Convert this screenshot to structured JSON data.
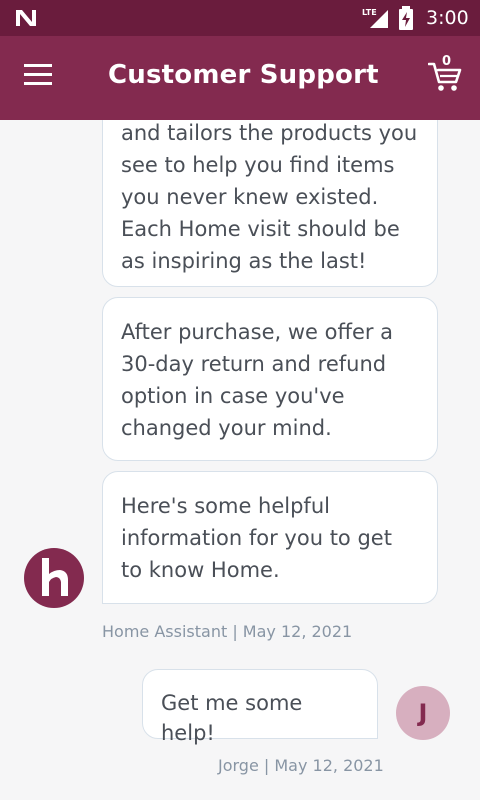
{
  "status_bar": {
    "network": "LTE",
    "time": "3:00"
  },
  "app_bar": {
    "title": "Customer Support",
    "cart_count": "0",
    "icons": [
      "menu-icon",
      "cart-icon"
    ]
  },
  "messages": [
    {
      "sender": "bot",
      "text": "and tailors the products you see to help you find items you never knew existed. Each Home visit should be as inspiring as the last!"
    },
    {
      "sender": "bot",
      "text": "After purchase, we offer a 30-day return and refund option in case you've changed your mind."
    },
    {
      "sender": "bot",
      "text": "Here's some helpful information for you to get to know Home."
    },
    {
      "sender": "user",
      "text": "Get me some help!"
    }
  ],
  "bot_meta": {
    "name": "Home Assistant",
    "separator": " | ",
    "date": "May 12, 2021"
  },
  "user_meta": {
    "name": "Jorge",
    "separator": " | ",
    "date": "May 12, 2021",
    "initial": "J"
  },
  "colors": {
    "status_bar": "#6a1c3d",
    "app_bar": "#832a4f",
    "background": "#f6f6f7",
    "bubble_border": "#d8e1ea",
    "user_avatar": "#d7afbf",
    "meta_text": "#8895a4"
  }
}
